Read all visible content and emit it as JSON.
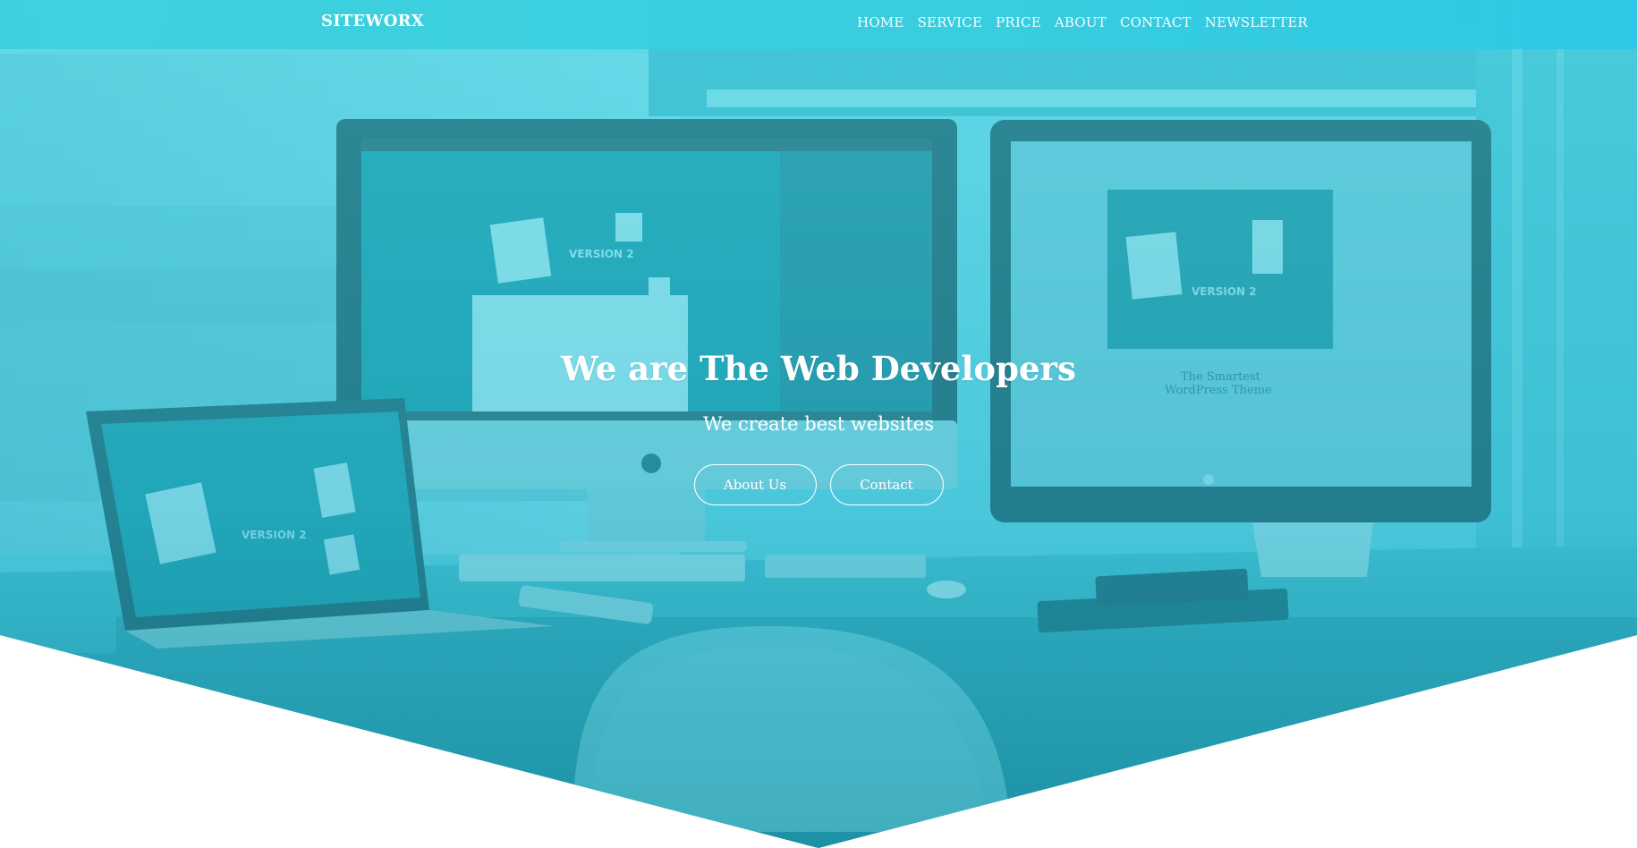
{
  "brand": {
    "name": "SITEWORX"
  },
  "nav": {
    "items": [
      {
        "label": "HOME"
      },
      {
        "label": "SERVICE"
      },
      {
        "label": "PRICE"
      },
      {
        "label": "ABOUT"
      },
      {
        "label": "CONTACT"
      },
      {
        "label": "NEWSLETTER"
      }
    ]
  },
  "hero": {
    "title": "We are The Web Developers",
    "subtitle": "We create best websites",
    "buttons": {
      "about": "About Us",
      "contact": "Contact"
    }
  },
  "colors": {
    "accent": "#3dd1dd",
    "overlay": "#2ec7e6",
    "text": "#ffffff",
    "background": "#ffffff"
  },
  "icons": [
    "apple-logo-icon",
    "fox-logo-icon"
  ]
}
